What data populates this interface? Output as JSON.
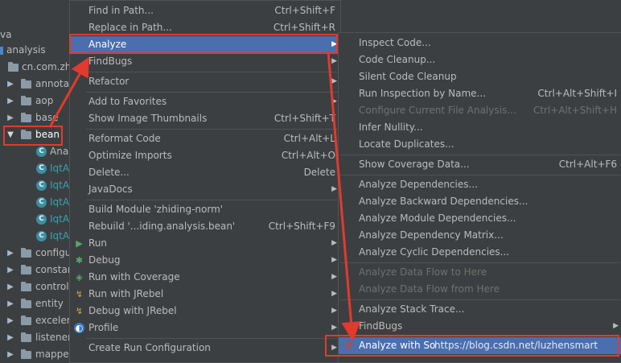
{
  "tree": {
    "root_partial": "va",
    "module": "analysis",
    "package": "cn.com.zhi",
    "folders_top": [
      "annotat",
      "aop",
      "base"
    ],
    "bean": "bean",
    "classes": [
      "Ana",
      "IqtA",
      "IqtA",
      "IqtA",
      "IqtA",
      "IqtA"
    ],
    "class_letter": "C",
    "folders_bottom": [
      "configu",
      "constar",
      "control",
      "entity",
      "exceler",
      "listener",
      "mappe"
    ]
  },
  "menu1": {
    "find_in_path": "Find in Path...",
    "find_in_path_sc": "Ctrl+Shift+F",
    "replace_in_path": "Replace in Path...",
    "replace_in_path_sc": "Ctrl+Shift+R",
    "analyze": "Analyze",
    "findbugs": "FindBugs",
    "refactor": "Refactor",
    "add_to_favorites": "Add to Favorites",
    "show_image_thumbnails": "Show Image Thumbnails",
    "show_image_thumbnails_sc": "Ctrl+Shift+T",
    "reformat_code": "Reformat Code",
    "reformat_code_sc": "Ctrl+Alt+L",
    "optimize_imports": "Optimize Imports",
    "optimize_imports_sc": "Ctrl+Alt+O",
    "delete": "Delete...",
    "delete_sc": "Delete",
    "javadocs": "JavaDocs",
    "build_module": "Build Module 'zhiding-norm'",
    "rebuild": "Rebuild '...iding.analysis.bean'",
    "rebuild_sc": "Ctrl+Shift+F9",
    "run": "Run",
    "debug": "Debug",
    "run_with_coverage": "Run with Coverage",
    "run_with_jrebel": "Run with JRebel",
    "debug_with_jrebel": "Debug with JRebel",
    "profile": "Profile",
    "create_run_configuration": "Create Run Configuration"
  },
  "menu2": {
    "inspect_code": "Inspect Code...",
    "code_cleanup": "Code Cleanup...",
    "silent_code_cleanup": "Silent Code Cleanup",
    "run_inspection_by_name": "Run Inspection by Name...",
    "run_inspection_by_name_sc": "Ctrl+Alt+Shift+I",
    "configure_current_file_analysis": "Configure Current File Analysis...",
    "configure_current_file_analysis_sc": "Ctrl+Alt+Shift+H",
    "infer_nullity": "Infer Nullity...",
    "locate_duplicates": "Locate Duplicates...",
    "show_coverage_data": "Show Coverage Data...",
    "show_coverage_data_sc": "Ctrl+Alt+F6",
    "analyze_dependencies": "Analyze Dependencies...",
    "analyze_backward_dependencies": "Analyze Backward Dependencies...",
    "analyze_module_dependencies": "Analyze Module Dependencies...",
    "analyze_dependency_matrix": "Analyze Dependency Matrix...",
    "analyze_cyclic_dependencies": "Analyze Cyclic Dependencies...",
    "analyze_data_flow_to_here": "Analyze Data Flow to Here",
    "analyze_data_flow_from_here": "Analyze Data Flow from Here",
    "analyze_stack_trace": "Analyze Stack Trace...",
    "findbugs": "FindBugs",
    "analyze_with_sonar": "Analyze with So"
  },
  "watermark": "https://blog.csdn.net/luzhensmart",
  "colors": {
    "selection": "#4b6eaf",
    "annotation_red": "#e23a2e",
    "menu_bg": "#3c3f41"
  }
}
